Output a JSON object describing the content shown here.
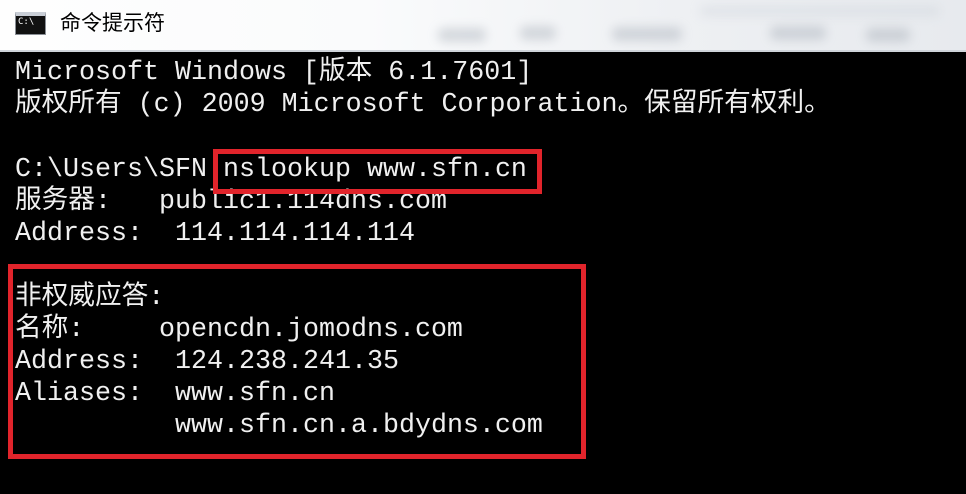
{
  "window": {
    "title": "命令提示符",
    "icon": "command-prompt-icon",
    "icon_label": "C:\\"
  },
  "console": {
    "version": "Microsoft Windows [版本 6.1.7601]",
    "copyright": "版权所有 (c) 2009 Microsoft Corporation。保留所有权利。",
    "prompt": "C:\\Users\\SFN",
    "command": "nslookup www.sfn.cn",
    "server_label": "服务器:",
    "server_value": "public1.114dns.com",
    "server_address_label": "Address:",
    "server_address_value": "114.114.114.114",
    "nonauth_header": "非权威应答:",
    "name_label": "名称:",
    "name_value": "opencdn.jomodns.com",
    "address_label": "Address:",
    "address_value": "124.238.241.35",
    "aliases_label": "Aliases:",
    "aliases": [
      "www.sfn.cn",
      "www.sfn.cn.a.bdydns.com"
    ]
  },
  "colors": {
    "console_background": "#000000",
    "console_text": "#f0f0f0",
    "highlight_border": "#e1242b",
    "title_text": "#000000"
  }
}
